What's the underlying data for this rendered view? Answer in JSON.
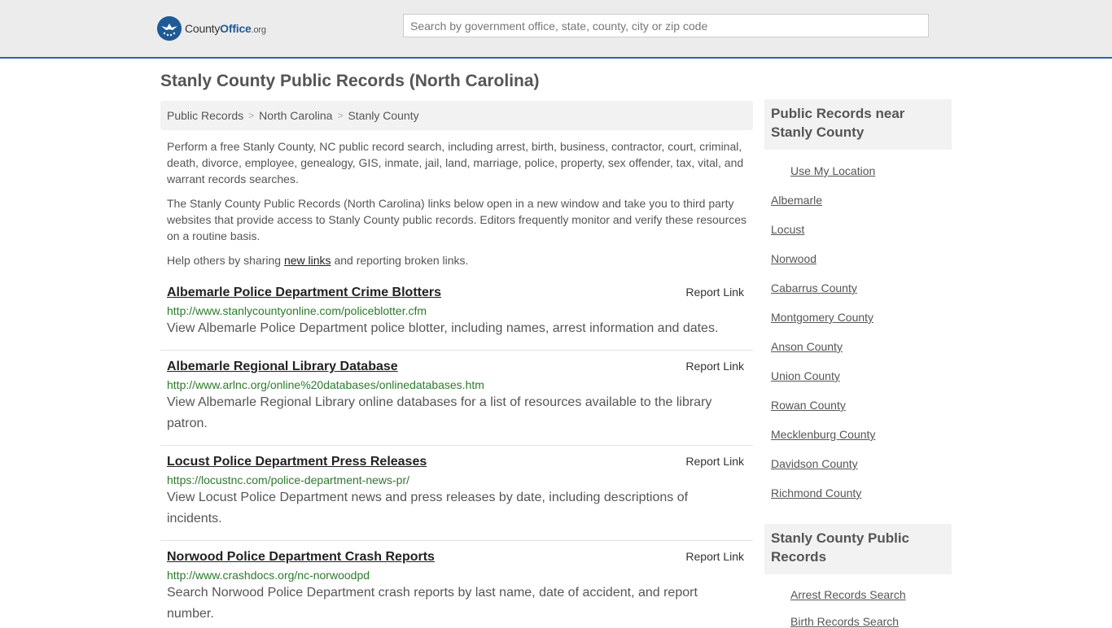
{
  "header": {
    "logo_prefix": "County",
    "logo_bold": "Office",
    "logo_suffix": ".org",
    "search_placeholder": "Search by government office, state, county, city or zip code"
  },
  "page_title": "Stanly County Public Records (North Carolina)",
  "breadcrumb": [
    "Public Records",
    "North Carolina",
    "Stanly County"
  ],
  "intro": {
    "p1": "Perform a free Stanly County, NC public record search, including arrest, birth, business, contractor, court, criminal, death, divorce, employee, genealogy, GIS, inmate, jail, land, marriage, police, property, sex offender, tax, vital, and warrant records searches.",
    "p2": "The Stanly County Public Records (North Carolina) links below open in a new window and take you to third party websites that provide access to Stanly County public records. Editors frequently monitor and verify these resources on a routine basis.",
    "p3_before": "Help others by sharing ",
    "p3_link": "new links",
    "p3_after": " and reporting broken links."
  },
  "records": [
    {
      "title": "Albemarle Police Department Crime Blotters",
      "report": "Report Link",
      "url": "http://www.stanlycountyonline.com/policeblotter.cfm",
      "desc": "View Albemarle Police Department police blotter, including names, arrest information and dates."
    },
    {
      "title": "Albemarle Regional Library Database",
      "report": "Report Link",
      "url": "http://www.arlnc.org/online%20databases/onlinedatabases.htm",
      "desc": "View Albemarle Regional Library online databases for a list of resources available to the library patron."
    },
    {
      "title": "Locust Police Department Press Releases",
      "report": "Report Link",
      "url": "https://locustnc.com/police-department-news-pr/",
      "desc": "View Locust Police Department news and press releases by date, including descriptions of incidents."
    },
    {
      "title": "Norwood Police Department Crash Reports",
      "report": "Report Link",
      "url": "http://www.crashdocs.org/nc-norwoodpd",
      "desc": "Search Norwood Police Department crash reports by last name, date of accident, and report number."
    }
  ],
  "sidebar": {
    "nearby_title": "Public Records near Stanly County",
    "use_location": "Use My Location",
    "nearby": [
      "Albemarle",
      "Locust",
      "Norwood",
      "Cabarrus County",
      "Montgomery County",
      "Anson County",
      "Union County",
      "Rowan County",
      "Mecklenburg County",
      "Davidson County",
      "Richmond County"
    ],
    "county_title": "Stanly County Public Records",
    "county_links": [
      "Arrest Records Search",
      "Birth Records Search"
    ]
  },
  "colors": {
    "brand_blue": "#1f5a96",
    "url_green": "#2c7a2c",
    "header_bg": "#ececec"
  }
}
